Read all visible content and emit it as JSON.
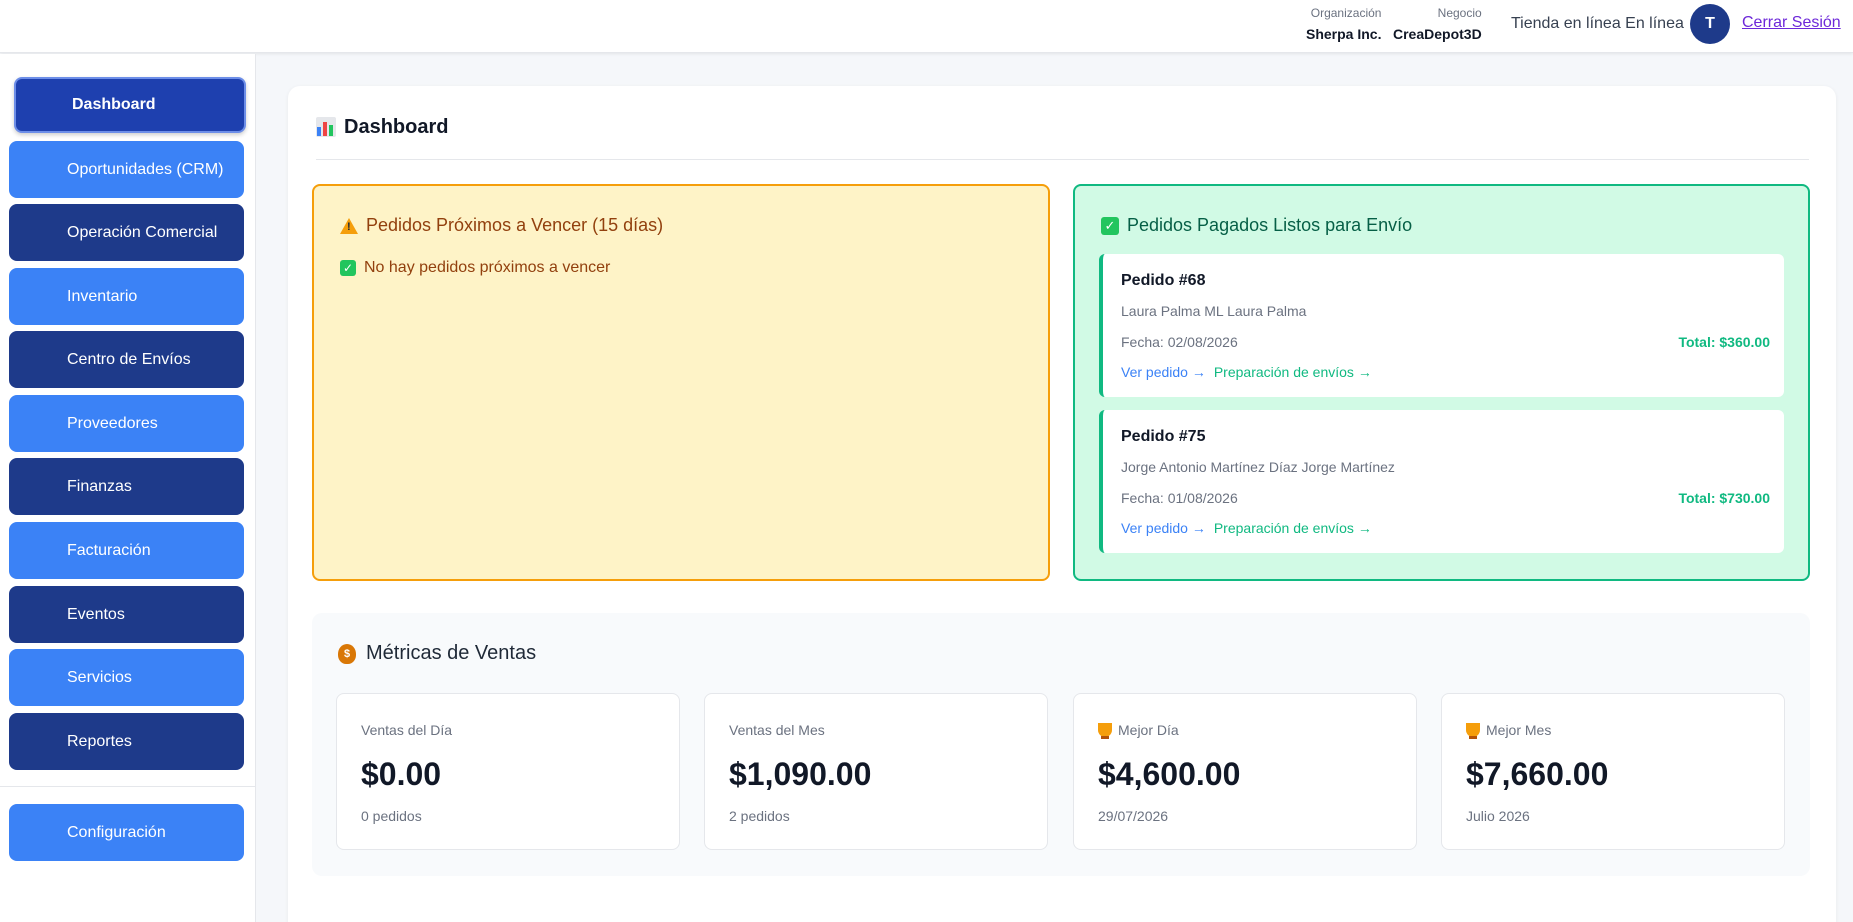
{
  "header": {
    "org_label": "Organización",
    "org_value": "Sherpa Inc.",
    "business_label": "Negocio",
    "business_value": "CreaDepot3D",
    "store_status": "Tienda en línea En línea",
    "avatar_initial": "T",
    "logout_label": "Cerrar Sesión"
  },
  "sidebar": {
    "items": [
      {
        "label": "Dashboard"
      },
      {
        "label": "Oportunidades (CRM)"
      },
      {
        "label": "Operación Comercial"
      },
      {
        "label": "Inventario"
      },
      {
        "label": "Centro de Envíos"
      },
      {
        "label": "Proveedores"
      },
      {
        "label": "Finanzas"
      },
      {
        "label": "Facturación"
      },
      {
        "label": "Eventos"
      },
      {
        "label": "Servicios"
      },
      {
        "label": "Reportes"
      }
    ],
    "settings_label": "Configuración"
  },
  "page": {
    "title": "Dashboard"
  },
  "upcoming": {
    "title": "Pedidos Próximos a Vencer (15 días)",
    "empty_message": "No hay pedidos próximos a vencer"
  },
  "paid": {
    "title": "Pedidos Pagados Listos para Envío",
    "orders": [
      {
        "title": "Pedido #68",
        "customer": "Laura Palma ML Laura Palma",
        "date": "Fecha: 02/08/2026",
        "total": "Total: $360.00",
        "view_link": "Ver pedido →",
        "ship_link": "Preparación de envíos →"
      },
      {
        "title": "Pedido #75",
        "customer": "Jorge Antonio Martínez Díaz Jorge Martínez",
        "date": "Fecha: 01/08/2026",
        "total": "Total: $730.00",
        "view_link": "Ver pedido →",
        "ship_link": "Preparación de envíos →"
      }
    ]
  },
  "metrics": {
    "title": "Métricas de Ventas",
    "cards": [
      {
        "label": "Ventas del Día",
        "value": "$0.00",
        "sub": "0 pedidos"
      },
      {
        "label": "Ventas del Mes",
        "value": "$1,090.00",
        "sub": "2 pedidos"
      },
      {
        "label": "Mejor Día",
        "value": "$4,600.00",
        "sub": "29/07/2026"
      },
      {
        "label": "Mejor Mes",
        "value": "$7,660.00",
        "sub": "Julio 2026"
      }
    ]
  },
  "colors": {
    "nav_light": "#3b82f6",
    "nav_dark": "#1e3a8a",
    "warning_bg": "#fef3c7",
    "warning_border": "#f59e0b",
    "success_bg": "#d1fae5",
    "success_border": "#10b981"
  },
  "icons": {
    "page_title": "bar-chart-icon",
    "warning": "warning-icon",
    "check": "check-box-icon",
    "metrics": "money-bag-icon",
    "best": "trophy-icon"
  }
}
